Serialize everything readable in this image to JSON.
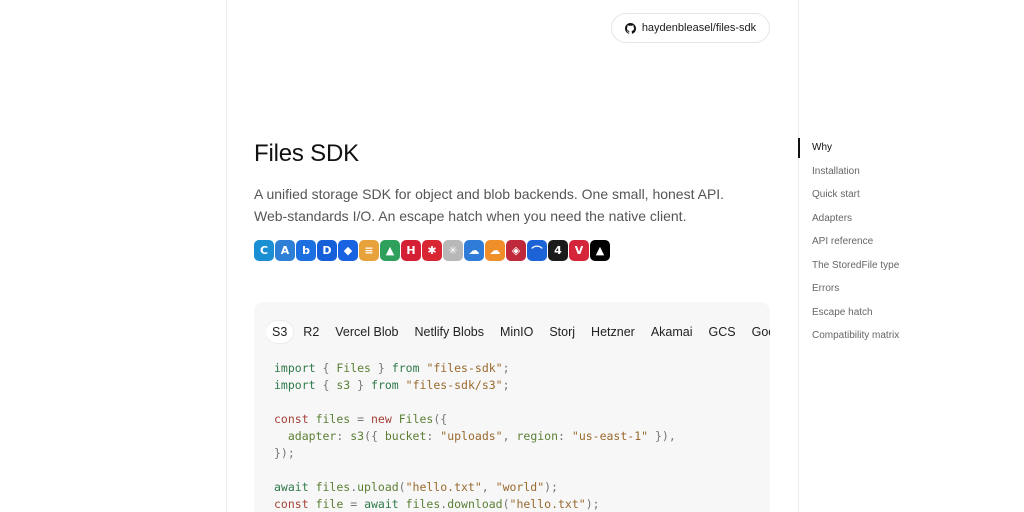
{
  "header": {
    "repo_label": "haydenbleasel/files-sdk"
  },
  "hero": {
    "title": "Files SDK",
    "description": "A unified storage SDK for object and blob backends. One small, honest API. Web-standards I/O. An escape hatch when you need the native client."
  },
  "providers": [
    {
      "name": "cloudflare-logo",
      "color": "#1a8fd4",
      "glyph": "C"
    },
    {
      "name": "azure-logo",
      "color": "#2e7fd6",
      "glyph": "A"
    },
    {
      "name": "box-logo",
      "color": "#1b6fe0",
      "glyph": "b"
    },
    {
      "name": "digitalocean-logo",
      "color": "#1560d8",
      "glyph": "D"
    },
    {
      "name": "dropbox-logo",
      "color": "#1963e3",
      "glyph": "◆"
    },
    {
      "name": "backblaze-logo",
      "color": "#e7a23b",
      "glyph": "≡"
    },
    {
      "name": "google-drive-logo",
      "color": "#2fa05b",
      "glyph": "▲"
    },
    {
      "name": "hetzner-logo",
      "color": "#d51f35",
      "glyph": "H"
    },
    {
      "name": "wasabi-logo",
      "color": "#d82632",
      "glyph": "✱"
    },
    {
      "name": "tigris-logo",
      "color": "#b8b8b8",
      "glyph": "✳"
    },
    {
      "name": "onedrive-logo",
      "color": "#2f7bd8",
      "glyph": "☁"
    },
    {
      "name": "storj-logo",
      "color": "#f08e2a",
      "glyph": "☁"
    },
    {
      "name": "filebase-logo",
      "color": "#c0283c",
      "glyph": "◈"
    },
    {
      "name": "akamai-logo",
      "color": "#1c63d8",
      "glyph": "⌒"
    },
    {
      "name": "minio-logo",
      "color": "#1b1b1b",
      "glyph": "4"
    },
    {
      "name": "vultr-logo",
      "color": "#d5253a",
      "glyph": "V"
    },
    {
      "name": "vercel-logo",
      "color": "#000000",
      "glyph": "▲"
    }
  ],
  "code_card": {
    "tabs": [
      "S3",
      "R2",
      "Vercel Blob",
      "Netlify Blobs",
      "MinIO",
      "Storj",
      "Hetzner",
      "Akamai",
      "GCS",
      "Google Drive"
    ],
    "active_tab": "S3"
  },
  "toc": {
    "items": [
      "Why",
      "Installation",
      "Quick start",
      "Adapters",
      "API reference",
      "The StoredFile type",
      "Errors",
      "Escape hatch",
      "Compatibility matrix"
    ],
    "active": "Why"
  },
  "colors": {
    "keyword": "#2f7a4a",
    "keyword_alt": "#a34238",
    "string": "#9a6a2e",
    "card_bg": "#f7f7f7"
  }
}
